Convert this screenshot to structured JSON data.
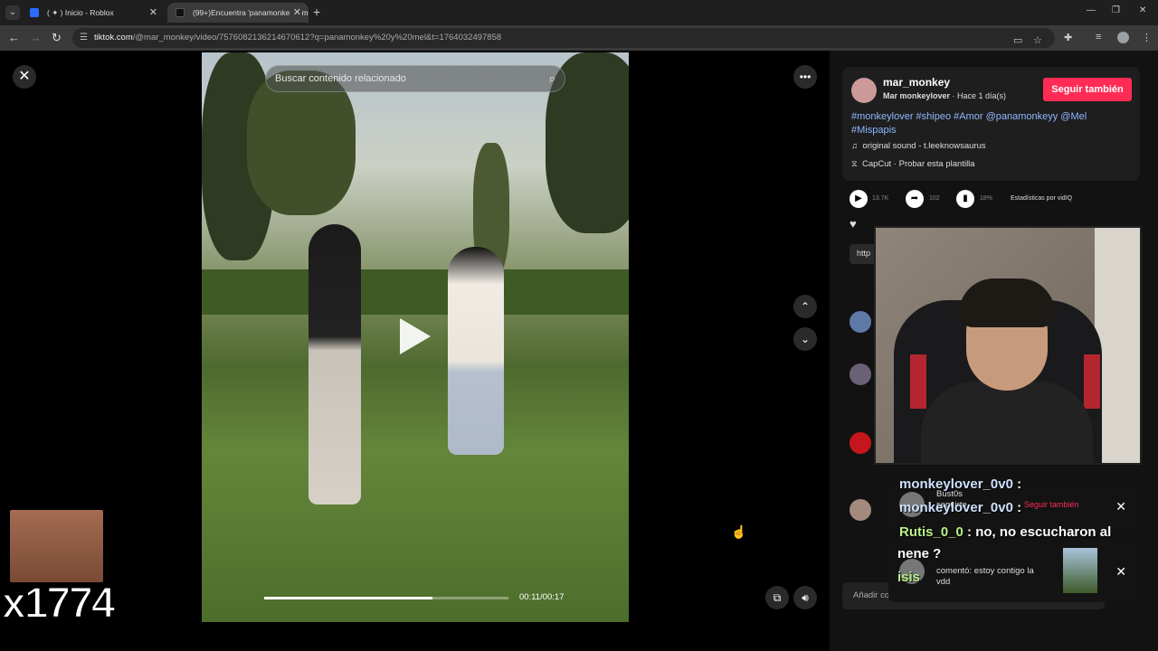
{
  "browser": {
    "tabs": [
      {
        "title": "( ✦ ) Inicio - Roblox",
        "active": false,
        "favicon_color": "#2c6bff"
      },
      {
        "title": "(99+)Encuentra 'panamonkey y mel'",
        "active": true,
        "favicon_color": "#111111"
      }
    ],
    "url_domain": "tiktok.com",
    "url_path": "/@mar_monkey/video/7576082136214670612?q=panamonkey%20y%20mel&t=1764032497858",
    "profile_initial": "I"
  },
  "video": {
    "search_placeholder": "Buscar contenido relacionado",
    "time": "00:11/00:17",
    "progress": 0.69
  },
  "overlay": {
    "counter": "x1774"
  },
  "post": {
    "author": "mar_monkey",
    "display_name": "Mar monkeylover",
    "age": "Hace 1 día(s)",
    "follow_label": "Seguir también",
    "caption": "#monkeylover #shipeo #Amor @panamonkeyy @Mel #Mispapis",
    "sound": "original sound - t.leeknowsaurus",
    "capcut": "CapCut · Probar esta plantilla",
    "stats": {
      "plays": "13.7K",
      "shares": "102",
      "percent": "18%",
      "vidiq_label": "Estadísticas por vidIQ"
    },
    "link_prefix": "http",
    "comment_placeholder": "Añadir co"
  },
  "chat": [
    {
      "user": "monkeylover_0v0",
      "message": ""
    },
    {
      "user": "monkeylover_0v0",
      "message": ""
    },
    {
      "user": "Rutis_0_0",
      "message": "no, no escucharon al"
    },
    {
      "user": "",
      "message": "nene ?"
    },
    {
      "user": "isis",
      "message": ""
    }
  ],
  "notifications": [
    {
      "text_line1": "Bust0s",
      "text_line2": "seguirte.",
      "follow_label": "Seguir también"
    },
    {
      "text": "comentó: estoy contigo la vdd"
    }
  ],
  "colors": {
    "accent": "#fe2c55",
    "hashtag": "#8fb7ff"
  }
}
